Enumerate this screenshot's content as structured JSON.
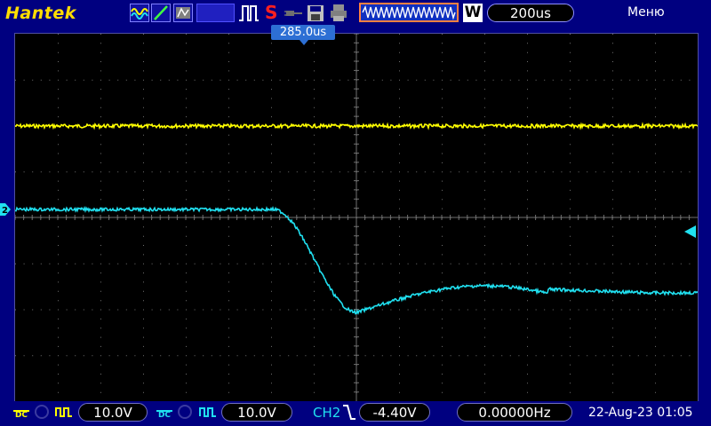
{
  "brand": "Hantek",
  "toolbar": {
    "run_state": "S",
    "wave_mode": "W",
    "timebase": "200us",
    "menu": "Меню",
    "icons": [
      "waveform-icon",
      "line-icon",
      "measure-icon",
      "blank-icon",
      "pulse-icon",
      "plug-icon",
      "save-icon",
      "print-icon",
      "memory-window-icon"
    ]
  },
  "trigger_position": "285.0us",
  "bottom": {
    "ch1": {
      "coupling": "DC",
      "volts_div": "10.0V"
    },
    "ch2": {
      "coupling": "DC",
      "volts_div": "10.0V"
    },
    "trigger": {
      "source": "CH2",
      "level": "-4.40V"
    },
    "frequency": "0.00000Hz",
    "datetime": "22-Aug-23 01:05"
  },
  "colors": {
    "ch1": "#ffff00",
    "ch2": "#20e0f0",
    "background": "#000080",
    "grid": "#707070"
  }
}
